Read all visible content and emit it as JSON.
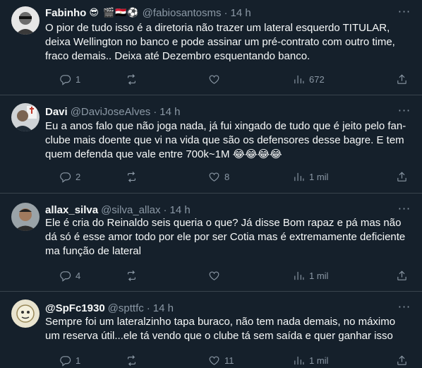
{
  "tweets": [
    {
      "name": "Fabinho",
      "name_emojis": "😎 🎬🇪🇬⚽",
      "handle": "@fabiosantosms",
      "time": "14 h",
      "text": "O pior de tudo isso é a diretoria não trazer um lateral esquerdo TITULAR, deixa Wellington no banco e pode assinar um pré-contrato com outro time, fraco demais.. Deixa até Dezembro esquentando banco.",
      "replies": "1",
      "retweets": "",
      "likes": "",
      "views": "672"
    },
    {
      "name": "Davi",
      "name_emojis": "",
      "handle": "@DaviJoseAlves",
      "time": "14 h",
      "text": "Eu a anos falo que não joga nada, já fui xingado de tudo que é jeito pelo fan-clube mais doente que vi na vida que são os defensores desse bagre. E tem quem defenda que vale entre 700k~1M 😂😂😂😂",
      "replies": "2",
      "retweets": "",
      "likes": "8",
      "views": "1 mil"
    },
    {
      "name": "allax_silva",
      "name_emojis": "",
      "handle": "@silva_allax",
      "time": "14 h",
      "text": "Ele é cria do Reinaldo seis queria o que? Já disse Bom rapaz e pá mas não dá só é esse amor todo por ele por ser Cotia mas é extremamente deficiente ma função de lateral",
      "replies": "4",
      "retweets": "",
      "likes": "",
      "views": "1 mil"
    },
    {
      "name": "@SpFc1930",
      "name_emojis": "",
      "handle": "@spttfc",
      "time": "14 h",
      "text": "Sempre foi um lateralzinho tapa buraco, não tem nada demais, no máximo um reserva útil...ele tá vendo que o clube tá sem saída e quer ganhar isso",
      "replies": "1",
      "retweets": "",
      "likes": "11",
      "views": "1 mil"
    }
  ],
  "icons": {
    "more": "more-horizontal-icon",
    "reply": "reply-icon",
    "retweet": "retweet-icon",
    "like": "heart-icon",
    "views": "views-chart-icon",
    "share": "share-icon"
  },
  "colors": {
    "background": "#15202b",
    "text": "#f7f9f9",
    "secondary": "#8b98a5",
    "divider": "#38444d"
  }
}
